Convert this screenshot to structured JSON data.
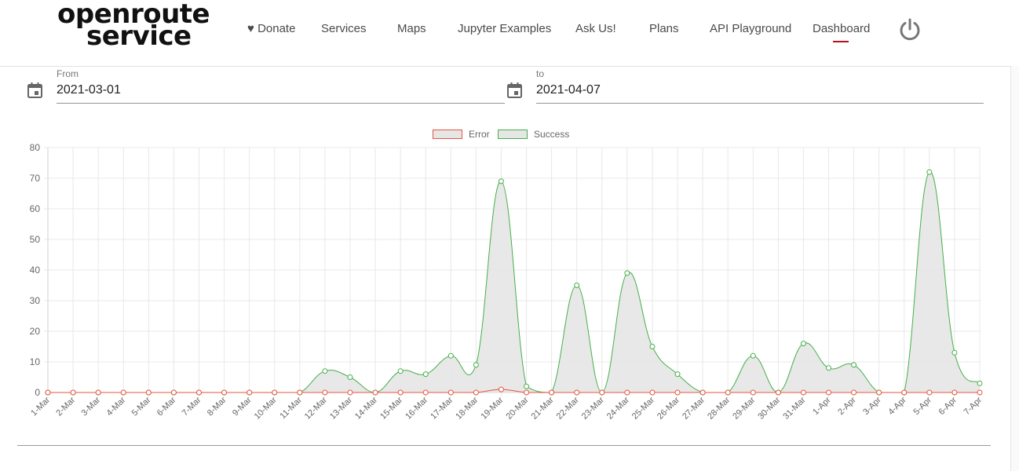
{
  "brand": {
    "line1": "openroute",
    "line2": "service"
  },
  "nav": {
    "items": [
      {
        "label": "♥ Donate"
      },
      {
        "label": "Services"
      },
      {
        "label": "Maps"
      },
      {
        "label": "Jupyter Examples"
      },
      {
        "label": "Ask Us!"
      },
      {
        "label": "Plans"
      },
      {
        "label": "API Playground"
      },
      {
        "label": "Dashboard",
        "active": true
      }
    ],
    "power_icon": "power-icon"
  },
  "filters": {
    "from": {
      "label": "From",
      "value": "2021-03-01",
      "icon": "calendar-icon"
    },
    "to": {
      "label": "to",
      "value": "2021-04-07",
      "icon": "calendar-icon"
    }
  },
  "colors": {
    "error": "#e8533f",
    "success": "#45b04a",
    "fill": "#e6e6e6",
    "accent": "#b5121b"
  },
  "chart_data": {
    "type": "area",
    "x": [
      "1-Mar",
      "2-Mar",
      "3-Mar",
      "4-Mar",
      "5-Mar",
      "6-Mar",
      "7-Mar",
      "8-Mar",
      "9-Mar",
      "10-Mar",
      "11-Mar",
      "12-Mar",
      "13-Mar",
      "14-Mar",
      "15-Mar",
      "16-Mar",
      "17-Mar",
      "18-Mar",
      "19-Mar",
      "20-Mar",
      "21-Mar",
      "22-Mar",
      "23-Mar",
      "24-Mar",
      "25-Mar",
      "26-Mar",
      "27-Mar",
      "28-Mar",
      "29-Mar",
      "30-Mar",
      "31-Mar",
      "1-Apr",
      "2-Apr",
      "3-Apr",
      "4-Apr",
      "5-Apr",
      "6-Apr",
      "7-Apr"
    ],
    "series": [
      {
        "name": "Error",
        "values": [
          0,
          0,
          0,
          0,
          0,
          0,
          0,
          0,
          0,
          0,
          0,
          0,
          0,
          0,
          0,
          0,
          0,
          0,
          1,
          0,
          0,
          0,
          0,
          0,
          0,
          0,
          0,
          0,
          0,
          0,
          0,
          0,
          0,
          0,
          0,
          0,
          0,
          0
        ]
      },
      {
        "name": "Success",
        "values": [
          0,
          0,
          0,
          0,
          0,
          0,
          0,
          0,
          0,
          0,
          0,
          7,
          5,
          0,
          7,
          6,
          12,
          9,
          69,
          2,
          0,
          35,
          0,
          39,
          15,
          6,
          0,
          0,
          12,
          0,
          16,
          8,
          9,
          0,
          0,
          72,
          13,
          3
        ]
      }
    ],
    "ylim": [
      0,
      80
    ],
    "yticks": [
      0,
      10,
      20,
      30,
      40,
      50,
      60,
      70,
      80
    ],
    "grid": true,
    "legend": "top-center"
  }
}
